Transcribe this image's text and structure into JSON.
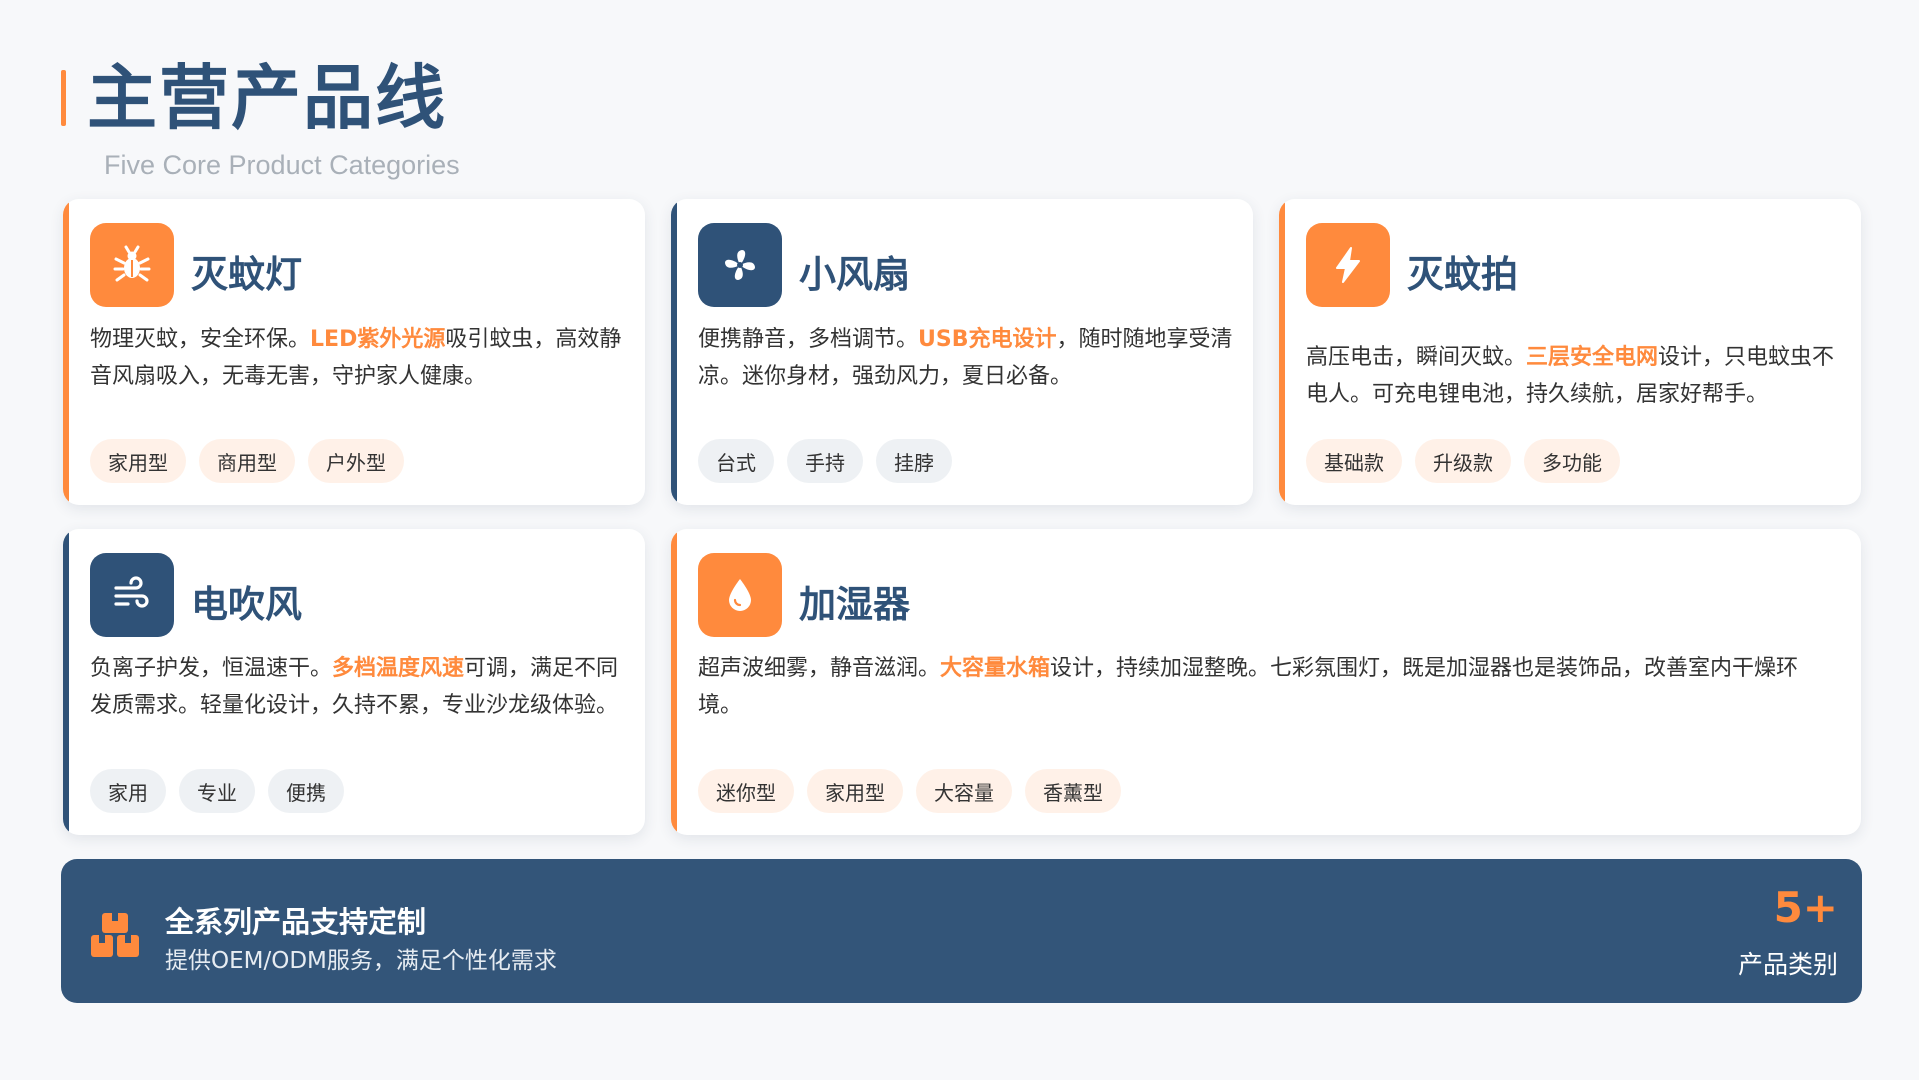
{
  "header": {
    "title": "主营产品线",
    "subtitle": "Five Core Product Categories"
  },
  "colors": {
    "accent_orange": "#ff8a3d",
    "brand_blue": "#2f5278",
    "banner_bg": "#335579"
  },
  "cards": [
    {
      "title": "灭蚊灯",
      "icon": "bug-icon",
      "accent": "orange",
      "desc_pre": "物理灭蚊，安全环保。",
      "desc_hl": "LED紫外光源",
      "desc_post": "吸引蚊虫，高效静音风扇吸入，无毒无害，守护家人健康。",
      "tags": [
        "家用型",
        "商用型",
        "户外型"
      ]
    },
    {
      "title": "小风扇",
      "icon": "fan-icon",
      "accent": "blue",
      "desc_pre": "便携静音，多档调节。",
      "desc_hl": "USB充电设计",
      "desc_post": "，随时随地享受清凉。迷你身材，强劲风力，夏日必备。",
      "tags": [
        "台式",
        "手持",
        "挂脖"
      ]
    },
    {
      "title": "灭蚊拍",
      "icon": "lightning-icon",
      "accent": "orange",
      "desc_pre": "高压电击，瞬间灭蚊。",
      "desc_hl": "三层安全电网",
      "desc_post": "设计，只电蚊虫不电人。可充电锂电池，持久续航，居家好帮手。",
      "tags": [
        "基础款",
        "升级款",
        "多功能"
      ]
    },
    {
      "title": "电吹风",
      "icon": "wind-icon",
      "accent": "blue",
      "desc_pre": "负离子护发，恒温速干。",
      "desc_hl": "多档温度风速",
      "desc_post": "可调，满足不同发质需求。轻量化设计，久持不累，专业沙龙级体验。",
      "tags": [
        "家用",
        "专业",
        "便携"
      ]
    },
    {
      "title": "加湿器",
      "icon": "water-drop-icon",
      "accent": "orange",
      "desc_pre": "超声波细雾，静音滋润。",
      "desc_hl": "大容量水箱",
      "desc_post": "设计，持续加湿整晚。七彩氛围灯，既是加湿器也是装饰品，改善室内干燥环境。",
      "tags": [
        "迷你型",
        "家用型",
        "大容量",
        "香薰型"
      ]
    }
  ],
  "banner": {
    "icon": "boxes-icon",
    "title": "全系列产品支持定制",
    "subtitle": "提供OEM/ODM服务，满足个性化需求",
    "count": "5+",
    "count_label": "产品类别"
  }
}
